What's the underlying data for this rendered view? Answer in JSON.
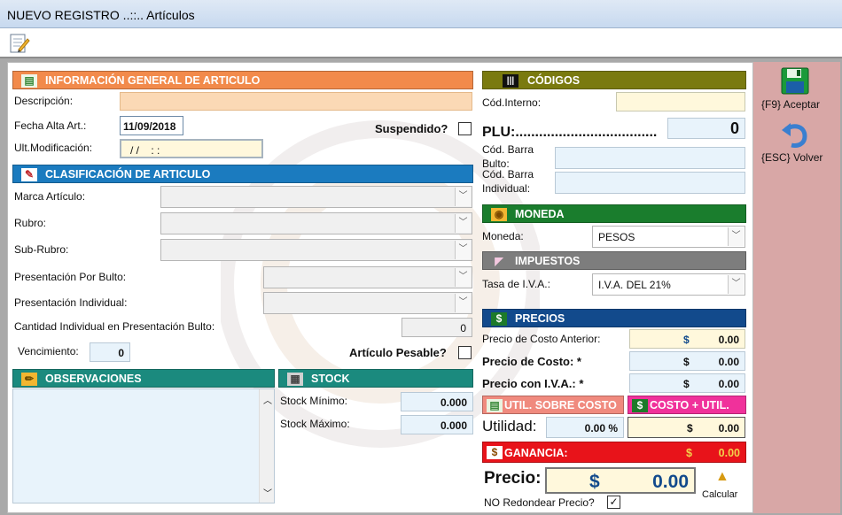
{
  "window": {
    "title": "NUEVO REGISTRO ..::.. Artículos"
  },
  "general": {
    "header": "INFORMACIÓN GENERAL DE ARTICULO",
    "descripcion_label": "Descripción:",
    "descripcion_value": "",
    "fecha_alta_label": "Fecha Alta Art.:",
    "fecha_alta_value": "11/09/2018",
    "ult_mod_label": "Ult.Modificación:",
    "ult_mod_value": "/ /    : :",
    "suspendido_label": "Suspendido?"
  },
  "clasificacion": {
    "header": "CLASIFICACIÓN DE ARTICULO",
    "marca_label": "Marca Artículo:",
    "rubro_label": "Rubro:",
    "subrubro_label": "Sub-Rubro:",
    "pres_bulto_label": "Presentación Por Bulto:",
    "pres_indiv_label": "Presentación Individual:",
    "cant_label": "Cantidad Individual en Presentación Bulto:",
    "cant_value": "0",
    "venc_label": "Vencimiento:",
    "venc_value": "0",
    "pesable_label": "Artículo Pesable?"
  },
  "observaciones": {
    "header": "OBSERVACIONES"
  },
  "stock": {
    "header": "STOCK",
    "min_label": "Stock Mínimo:",
    "min_value": "0.000",
    "max_label": "Stock Máximo:",
    "max_value": "0.000"
  },
  "codigos": {
    "header": "CÓDIGOS",
    "interno_label": "Cód.Interno:",
    "plu_label": "PLU:....................................",
    "plu_value": "0",
    "barra_bulto_label": "Cód. Barra Bulto:",
    "barra_indiv_label": "Cód. Barra Individual:"
  },
  "moneda": {
    "header": "MONEDA",
    "label": "Moneda:",
    "value": "PESOS"
  },
  "impuestos": {
    "header": "IMPUESTOS",
    "label": "Tasa de I.V.A.:",
    "value": "I.V.A. DEL 21%"
  },
  "precios": {
    "header": "PRECIOS",
    "costo_ant_label": "Precio de Costo Anterior:",
    "costo_label": "Precio de Costo: *",
    "con_iva_label": "Precio con I.V.A.: *",
    "currency": "$",
    "costo_ant_value": "0.00",
    "costo_value": "0.00",
    "con_iva_value": "0.00",
    "util_costo_btn": "UTIL. SOBRE COSTO",
    "costo_util_btn": "COSTO + UTIL.",
    "utilidad_label": "Utilidad:",
    "utilidad_pct": "0.00 %",
    "utilidad_value": "0.00",
    "ganancia_label": "GANANCIA:",
    "ganancia_value": "0.00",
    "precio_label": "Precio:",
    "precio_value": "0.00",
    "calcular_label": "Calcular",
    "no_redondear_label": "NO Redondear Precio?"
  },
  "actions": {
    "aceptar": "{F9} Aceptar",
    "volver": "{ESC} Volver"
  },
  "colors": {
    "orange": "#f28a4b",
    "blue": "#1b7bbf",
    "teal": "#1b8a7e",
    "olive": "#7a7a0f",
    "green": "#1a7d2d",
    "gray": "#7d7d7d",
    "navy": "#124a8c",
    "red": "#e8131a",
    "salmon": "#f08a7e",
    "pink": "#f0319b"
  }
}
